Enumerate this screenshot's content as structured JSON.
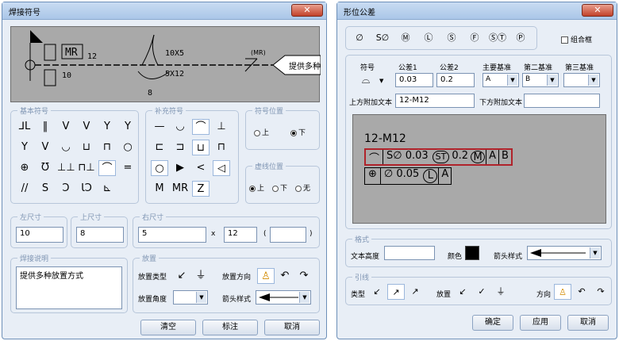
{
  "left": {
    "title": "焊接符号",
    "preview": {
      "tag": "MR",
      "num12": "12",
      "num10": "10",
      "size1": "10X5",
      "size2": "5X12",
      "num8": "8",
      "tail": "(MR)",
      "flag_text": "提供多种"
    },
    "groups": {
      "basic": "基本符号",
      "supplement": "补充符号",
      "position": "符号位置",
      "dashed": "虚线位置",
      "left_dim": "左尺寸",
      "top_dim": "上尺寸",
      "right_dim": "右尺寸",
      "desc": "焊接说明",
      "place": "放置"
    },
    "basic_symbols": [
      "⅃L",
      "‖",
      "V",
      "V",
      "Y",
      "Y",
      "Y",
      "V",
      "◡",
      "⊔",
      "⊓",
      "○",
      "⊕",
      "Ʊ",
      "⊥⊥",
      "⊓⊥",
      "⌒",
      "=",
      "//",
      "S",
      "Ɔ",
      "ƖƆ",
      "⊾"
    ],
    "supp_symbols": [
      "—",
      "◡",
      "⌒",
      "⊥",
      "⊏",
      "⊐",
      "⊔",
      "⊓",
      "○",
      "▶",
      "<",
      "◁",
      "M",
      "MR",
      "Z"
    ],
    "position_options": [
      "上",
      "下"
    ],
    "dashed_options": [
      "上",
      "下",
      "无"
    ],
    "left_value": "10",
    "top_value": "8",
    "right_value1": "5",
    "right_x": "x",
    "right_value2": "12",
    "paren_open": "(",
    "paren_close": ")",
    "desc_text": "提供多种放置方式",
    "place_type_label": "放置类型",
    "place_dir_label": "放置方向",
    "place_angle_label": "放置角度",
    "arrow_style_label": "箭头样式",
    "buttons": {
      "clear": "清空",
      "annotate": "标注",
      "cancel": "取消"
    }
  },
  "right": {
    "title": "形位公差",
    "top_symbols": [
      "∅",
      "S∅",
      "Ⓜ",
      "Ⓛ",
      "Ⓢ",
      "Ⓕ",
      "ⓈⓉ",
      "Ⓟ"
    ],
    "combo_frame": "组合框",
    "headers": {
      "symbol": "符号",
      "tol1": "公差1",
      "tol2": "公差2",
      "datum1": "主要基准",
      "datum2": "第二基准",
      "datum3": "第三基准"
    },
    "tol1_value": "0.03",
    "tol2_value": "0.2",
    "datum1_value": "A",
    "datum2_value": "B",
    "datum3_value": "",
    "upper_text_label": "上方附加文本",
    "upper_text_value": "12-M12",
    "lower_text_label": "下方附加文本",
    "lower_text_value": "",
    "preview": {
      "top_text": "12-M12",
      "row1": [
        "⌒",
        "S∅ 0.03",
        "ST",
        "0.2",
        "M",
        "A",
        "B"
      ],
      "row2": [
        "⊕",
        "∅ 0.05",
        "L",
        "A"
      ]
    },
    "format_group": "格式",
    "text_height_label": "文本高度",
    "color_label": "颜色",
    "color_value": "#000000",
    "arrow_style_label": "箭头样式",
    "leader_group": "引线",
    "type_label": "类型",
    "place_label": "放置",
    "direction_label": "方向",
    "buttons": {
      "ok": "确定",
      "apply": "应用",
      "cancel": "取消"
    }
  }
}
